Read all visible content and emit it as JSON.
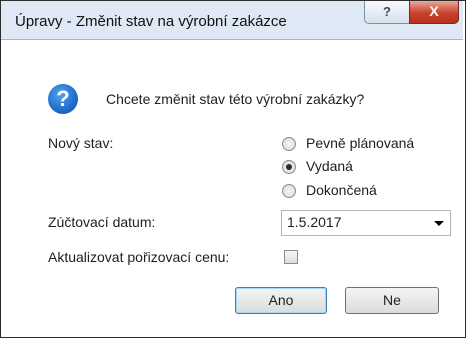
{
  "window": {
    "title": "Úpravy - Změnit stav na výrobní zakázce",
    "help_glyph": "?",
    "close_glyph": "X"
  },
  "dialog": {
    "icon": "question-icon",
    "question": "Chcete změnit stav této výrobní zakázky?",
    "new_state_label": "Nový stav:",
    "states": [
      {
        "label": "Pevně plánovaná",
        "selected": false
      },
      {
        "label": "Vydaná",
        "selected": true
      },
      {
        "label": "Dokončená",
        "selected": false
      }
    ],
    "posting_date_label": "Zúčtovací datum:",
    "posting_date_value": "1.5.2017",
    "update_cost_label": "Aktualizovat pořizovací cenu:",
    "update_cost_checked": false,
    "yes_label": "Ano",
    "no_label": "Ne"
  }
}
